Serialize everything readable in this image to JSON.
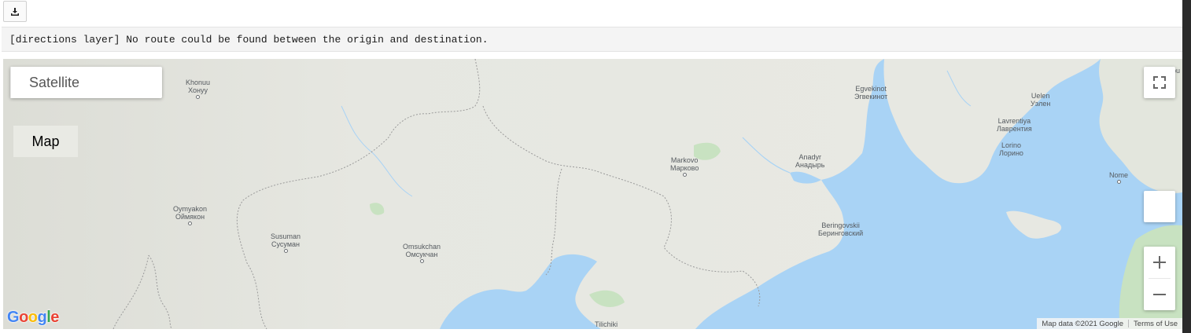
{
  "toolbar": {
    "download_icon": "download-icon"
  },
  "message": {
    "text": "[directions layer] No route could be found between the origin and destination."
  },
  "map": {
    "type_control": {
      "map_label": "Map",
      "satellite_label": "Satellite",
      "selected": "Map"
    },
    "places": {
      "khonuu": {
        "latin": "Khonuu",
        "cyrillic": "Хонуу"
      },
      "oymyakon": {
        "latin": "Oymyakon",
        "cyrillic": "Оймякон"
      },
      "susuman": {
        "latin": "Susuman",
        "cyrillic": "Сусуман"
      },
      "omsukchan": {
        "latin": "Omsukchan",
        "cyrillic": "Омсукчан"
      },
      "markovo": {
        "latin": "Markovo",
        "cyrillic": "Марково"
      },
      "egvekinot": {
        "latin": "Egvekinot",
        "cyrillic": "Эгвекинот"
      },
      "anadyr": {
        "latin": "Anadyr",
        "cyrillic": "Анадырь"
      },
      "beringovskii": {
        "latin": "Beringovskii",
        "cyrillic": "Беринговский"
      },
      "lavrentiya": {
        "latin": "Lavrentiya",
        "cyrillic": "Лаврентия"
      },
      "lorino": {
        "latin": "Lorino",
        "cyrillic": "Лорино"
      },
      "uelen": {
        "latin": "Uelen",
        "cyrillic": "Уэлен"
      },
      "nome": {
        "latin": "Nome"
      },
      "tilichiki": {
        "latin": "Tilichiki"
      },
      "corner_partial": "bu"
    },
    "attribution": {
      "data": "Map data ©2021 Google",
      "terms": "Terms of Use"
    },
    "logo_text": "Google",
    "controls": {
      "fullscreen_icon": "fullscreen-icon",
      "pegman_icon": "pegman-icon",
      "zoom_in": "+",
      "zoom_out": "−"
    },
    "colors": {
      "land": "#e9eae4",
      "water": "#a9d3f5",
      "forest": "#c8e2c1",
      "border": "#9a9a9a"
    }
  }
}
